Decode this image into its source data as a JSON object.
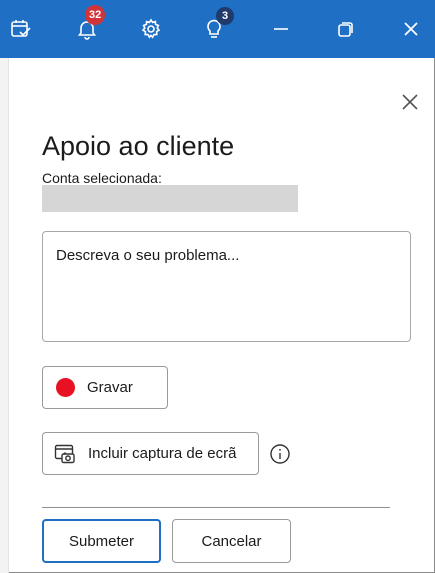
{
  "titlebar": {
    "notifications_count": "32",
    "tips_count": "3",
    "icons": [
      "task-check-icon",
      "bell-icon",
      "gear-icon",
      "lightbulb-icon",
      "minimize-icon",
      "restore-icon",
      "close-icon"
    ]
  },
  "panel": {
    "heading": "Apoio ao cliente",
    "account_label": "Conta selecionada:",
    "description_placeholder": "Descreva o seu problema...",
    "record_label": "Gravar",
    "screenshot_label": "Incluir captura de ecrã",
    "submit_label": "Submeter",
    "cancel_label": "Cancelar"
  },
  "colors": {
    "titlebar": "#1f6fc5",
    "badge_red": "#d13438",
    "badge_navy": "#203a6b",
    "record_dot": "#e81123"
  }
}
